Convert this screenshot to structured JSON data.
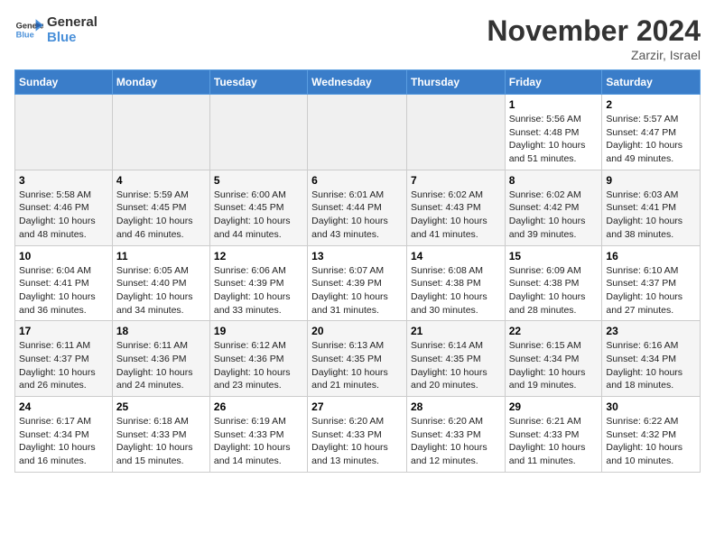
{
  "logo": {
    "name1": "General",
    "name2": "Blue"
  },
  "title": "November 2024",
  "location": "Zarzir, Israel",
  "days_of_week": [
    "Sunday",
    "Monday",
    "Tuesday",
    "Wednesday",
    "Thursday",
    "Friday",
    "Saturday"
  ],
  "weeks": [
    [
      {
        "day": "",
        "info": ""
      },
      {
        "day": "",
        "info": ""
      },
      {
        "day": "",
        "info": ""
      },
      {
        "day": "",
        "info": ""
      },
      {
        "day": "",
        "info": ""
      },
      {
        "day": "1",
        "info": "Sunrise: 5:56 AM\nSunset: 4:48 PM\nDaylight: 10 hours\nand 51 minutes."
      },
      {
        "day": "2",
        "info": "Sunrise: 5:57 AM\nSunset: 4:47 PM\nDaylight: 10 hours\nand 49 minutes."
      }
    ],
    [
      {
        "day": "3",
        "info": "Sunrise: 5:58 AM\nSunset: 4:46 PM\nDaylight: 10 hours\nand 48 minutes."
      },
      {
        "day": "4",
        "info": "Sunrise: 5:59 AM\nSunset: 4:45 PM\nDaylight: 10 hours\nand 46 minutes."
      },
      {
        "day": "5",
        "info": "Sunrise: 6:00 AM\nSunset: 4:45 PM\nDaylight: 10 hours\nand 44 minutes."
      },
      {
        "day": "6",
        "info": "Sunrise: 6:01 AM\nSunset: 4:44 PM\nDaylight: 10 hours\nand 43 minutes."
      },
      {
        "day": "7",
        "info": "Sunrise: 6:02 AM\nSunset: 4:43 PM\nDaylight: 10 hours\nand 41 minutes."
      },
      {
        "day": "8",
        "info": "Sunrise: 6:02 AM\nSunset: 4:42 PM\nDaylight: 10 hours\nand 39 minutes."
      },
      {
        "day": "9",
        "info": "Sunrise: 6:03 AM\nSunset: 4:41 PM\nDaylight: 10 hours\nand 38 minutes."
      }
    ],
    [
      {
        "day": "10",
        "info": "Sunrise: 6:04 AM\nSunset: 4:41 PM\nDaylight: 10 hours\nand 36 minutes."
      },
      {
        "day": "11",
        "info": "Sunrise: 6:05 AM\nSunset: 4:40 PM\nDaylight: 10 hours\nand 34 minutes."
      },
      {
        "day": "12",
        "info": "Sunrise: 6:06 AM\nSunset: 4:39 PM\nDaylight: 10 hours\nand 33 minutes."
      },
      {
        "day": "13",
        "info": "Sunrise: 6:07 AM\nSunset: 4:39 PM\nDaylight: 10 hours\nand 31 minutes."
      },
      {
        "day": "14",
        "info": "Sunrise: 6:08 AM\nSunset: 4:38 PM\nDaylight: 10 hours\nand 30 minutes."
      },
      {
        "day": "15",
        "info": "Sunrise: 6:09 AM\nSunset: 4:38 PM\nDaylight: 10 hours\nand 28 minutes."
      },
      {
        "day": "16",
        "info": "Sunrise: 6:10 AM\nSunset: 4:37 PM\nDaylight: 10 hours\nand 27 minutes."
      }
    ],
    [
      {
        "day": "17",
        "info": "Sunrise: 6:11 AM\nSunset: 4:37 PM\nDaylight: 10 hours\nand 26 minutes."
      },
      {
        "day": "18",
        "info": "Sunrise: 6:11 AM\nSunset: 4:36 PM\nDaylight: 10 hours\nand 24 minutes."
      },
      {
        "day": "19",
        "info": "Sunrise: 6:12 AM\nSunset: 4:36 PM\nDaylight: 10 hours\nand 23 minutes."
      },
      {
        "day": "20",
        "info": "Sunrise: 6:13 AM\nSunset: 4:35 PM\nDaylight: 10 hours\nand 21 minutes."
      },
      {
        "day": "21",
        "info": "Sunrise: 6:14 AM\nSunset: 4:35 PM\nDaylight: 10 hours\nand 20 minutes."
      },
      {
        "day": "22",
        "info": "Sunrise: 6:15 AM\nSunset: 4:34 PM\nDaylight: 10 hours\nand 19 minutes."
      },
      {
        "day": "23",
        "info": "Sunrise: 6:16 AM\nSunset: 4:34 PM\nDaylight: 10 hours\nand 18 minutes."
      }
    ],
    [
      {
        "day": "24",
        "info": "Sunrise: 6:17 AM\nSunset: 4:34 PM\nDaylight: 10 hours\nand 16 minutes."
      },
      {
        "day": "25",
        "info": "Sunrise: 6:18 AM\nSunset: 4:33 PM\nDaylight: 10 hours\nand 15 minutes."
      },
      {
        "day": "26",
        "info": "Sunrise: 6:19 AM\nSunset: 4:33 PM\nDaylight: 10 hours\nand 14 minutes."
      },
      {
        "day": "27",
        "info": "Sunrise: 6:20 AM\nSunset: 4:33 PM\nDaylight: 10 hours\nand 13 minutes."
      },
      {
        "day": "28",
        "info": "Sunrise: 6:20 AM\nSunset: 4:33 PM\nDaylight: 10 hours\nand 12 minutes."
      },
      {
        "day": "29",
        "info": "Sunrise: 6:21 AM\nSunset: 4:33 PM\nDaylight: 10 hours\nand 11 minutes."
      },
      {
        "day": "30",
        "info": "Sunrise: 6:22 AM\nSunset: 4:32 PM\nDaylight: 10 hours\nand 10 minutes."
      }
    ]
  ]
}
